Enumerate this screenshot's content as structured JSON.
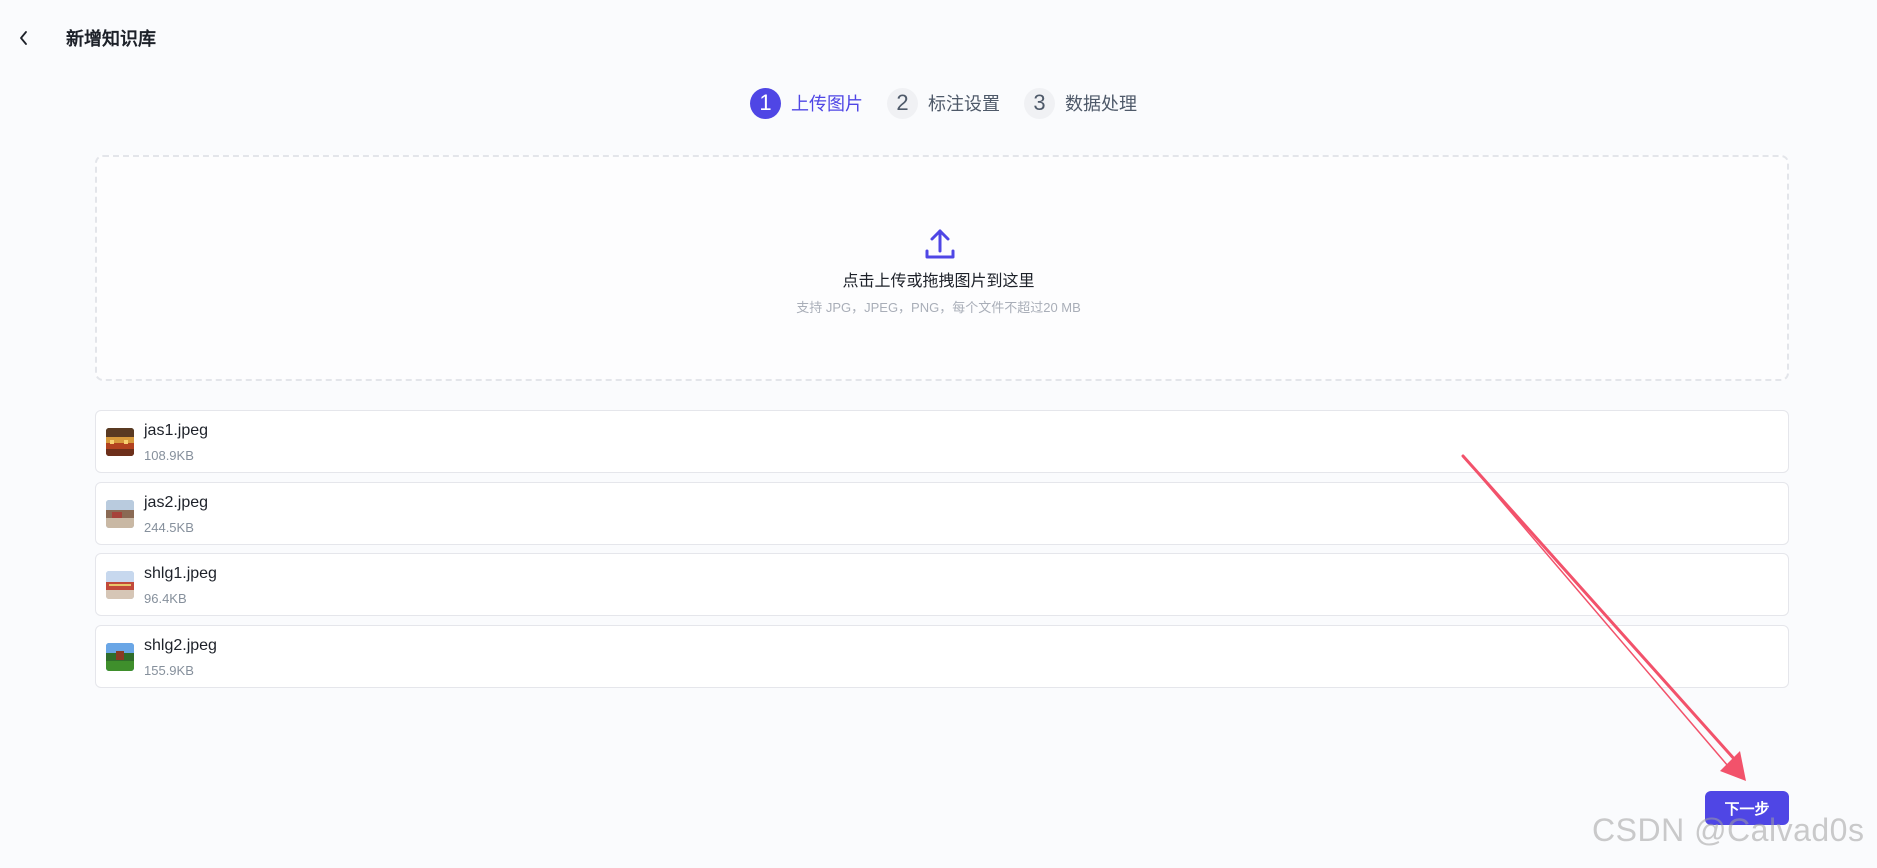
{
  "header": {
    "title": "新增知识库",
    "back_icon": "chevron-left-icon"
  },
  "steps": [
    {
      "number": "1",
      "label": "上传图片",
      "active": true
    },
    {
      "number": "2",
      "label": "标注设置",
      "active": false
    },
    {
      "number": "3",
      "label": "数据处理",
      "active": false
    }
  ],
  "upload": {
    "icon": "upload-icon",
    "title": "点击上传或拖拽图片到这里",
    "hint": "支持 JPG，JPEG，PNG，每个文件不超过20 MB"
  },
  "files": [
    {
      "name": "jas1.jpeg",
      "size": "108.9KB"
    },
    {
      "name": "jas2.jpeg",
      "size": "244.5KB"
    },
    {
      "name": "shlg1.jpeg",
      "size": "96.4KB"
    },
    {
      "name": "shlg2.jpeg",
      "size": "155.9KB"
    }
  ],
  "actions": {
    "next_label": "下一步"
  },
  "watermark": "CSDN @Calvad0s",
  "colors": {
    "accent": "#4f46e5",
    "annotation_arrow": "#f2526b"
  }
}
